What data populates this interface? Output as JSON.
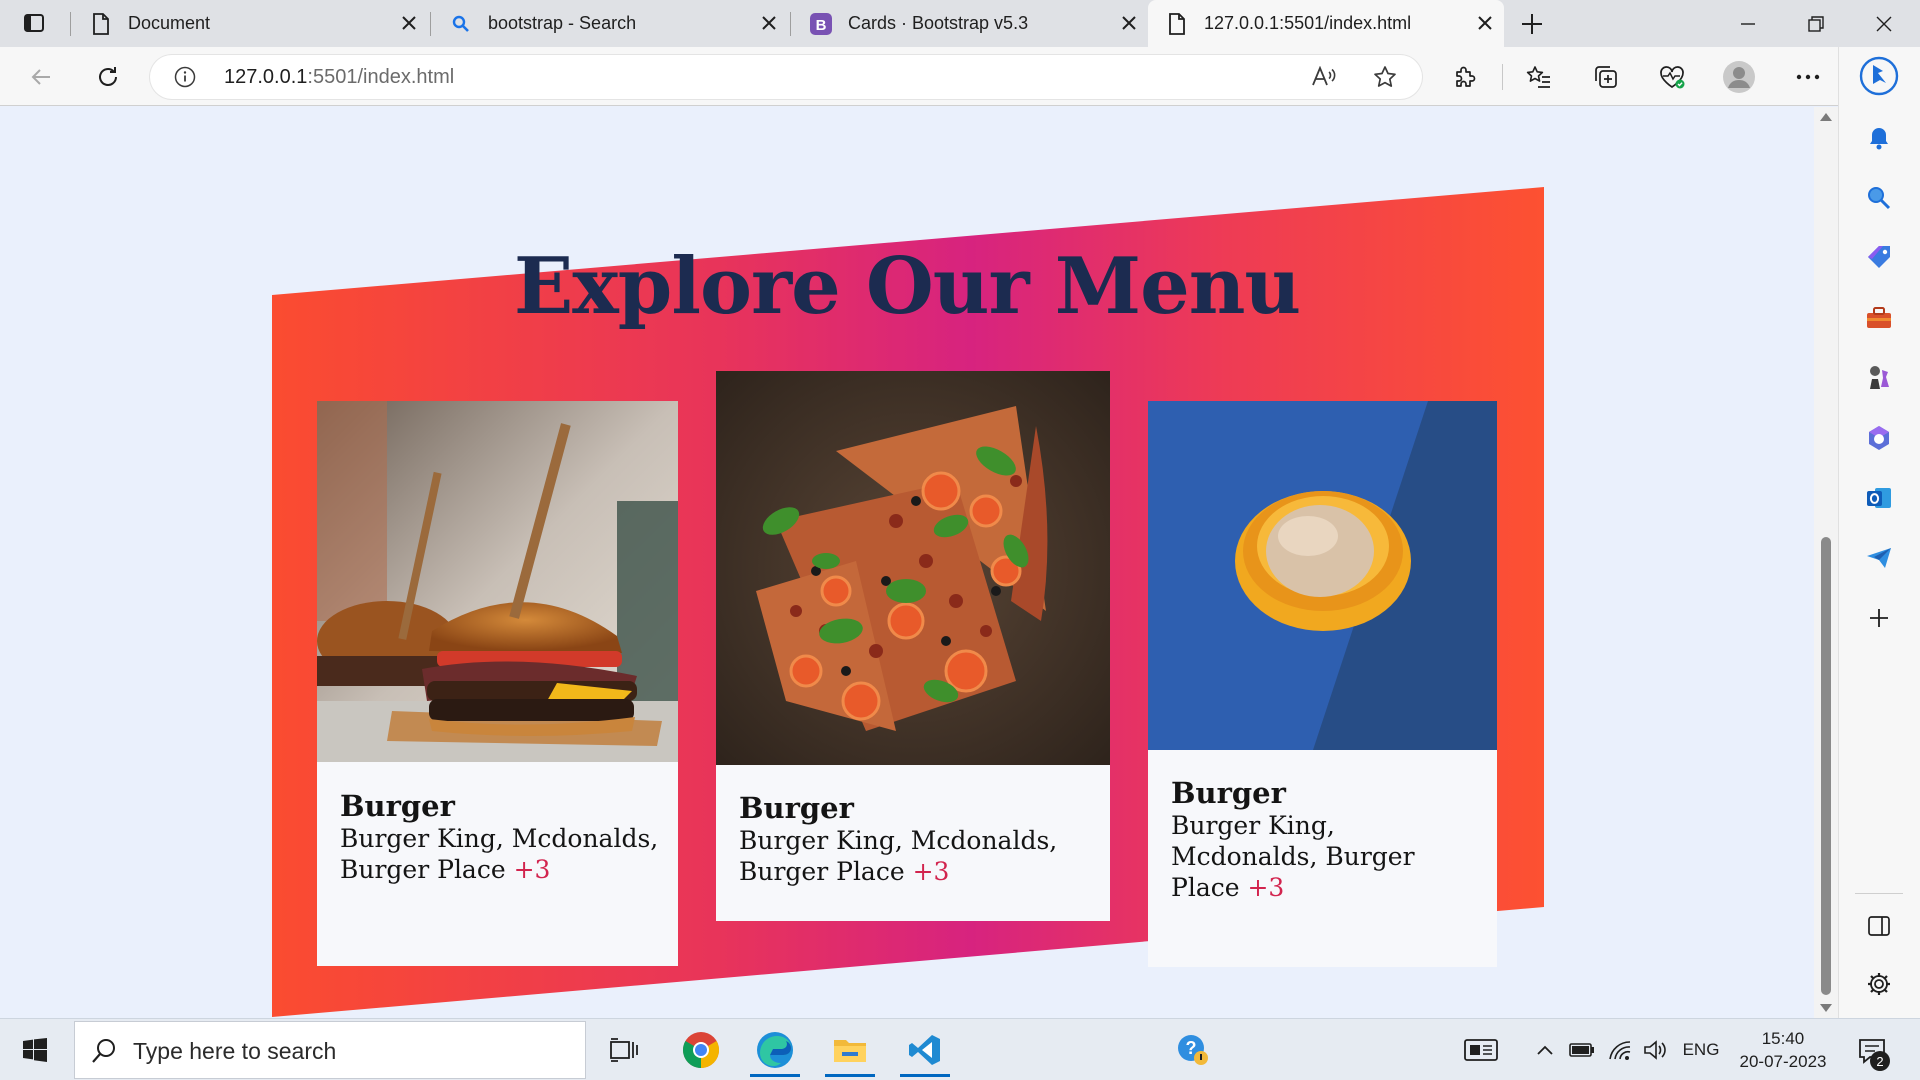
{
  "browser": {
    "tabs": [
      {
        "label": "Document",
        "icon": "page-icon",
        "active": false
      },
      {
        "label": "bootstrap - Search",
        "icon": "search-icon",
        "active": false
      },
      {
        "label": "Cards · Bootstrap v5.3",
        "icon": "bootstrap-icon",
        "active": false
      },
      {
        "label": "127.0.0.1:5501/index.html",
        "icon": "page-icon",
        "active": true
      }
    ],
    "address": {
      "host": "127.0.0.1",
      "path": ":5501/index.html"
    }
  },
  "page": {
    "title": "Explore Our Menu",
    "cards": [
      {
        "image": "burger-photo",
        "title": "Burger",
        "text": "Burger King, Mcdonalds, Burger Place",
        "more": "+3"
      },
      {
        "image": "pizza-photo",
        "title": "Burger",
        "text": "Burger King, Mcdonalds, Burger Place",
        "more": "+3"
      },
      {
        "image": "ice-cream-photo",
        "title": "Burger",
        "text": "Burger King, Mcdonalds, Burger Place",
        "more": "+3"
      }
    ],
    "colors": {
      "banner_start": "#fb4c30",
      "banner_mid": "#d7237f",
      "title": "#1c2b50",
      "more": "#d2244e"
    }
  },
  "taskbar": {
    "search_placeholder": "Type here to search",
    "language": "ENG",
    "time": "15:40",
    "date": "20-07-2023",
    "notification_count": "2"
  }
}
